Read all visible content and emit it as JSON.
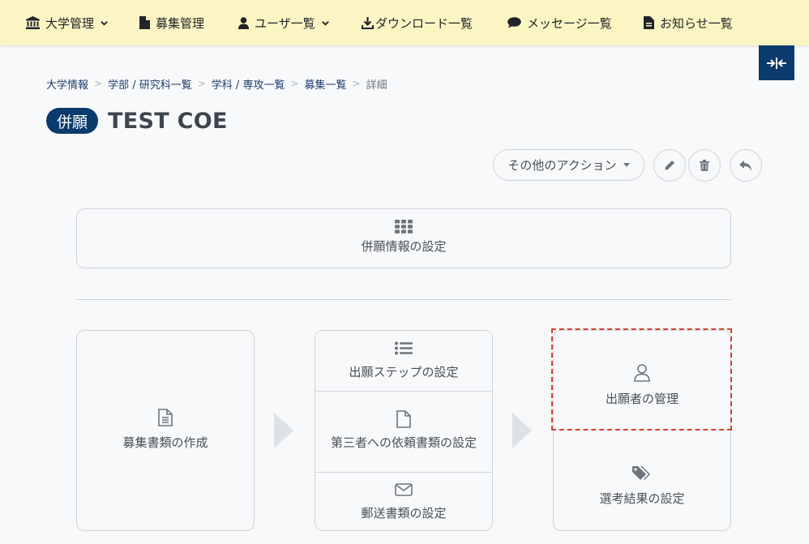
{
  "nav": {
    "items": [
      {
        "label": "大学管理",
        "icon": "university-icon",
        "dropdown": true
      },
      {
        "label": "募集管理",
        "icon": "file-icon",
        "dropdown": false
      },
      {
        "label": "ユーザ一覧",
        "icon": "user-icon",
        "dropdown": true
      },
      {
        "label": "ダウンロード一覧",
        "icon": "download-icon",
        "dropdown": false
      },
      {
        "label": "メッセージ一覧",
        "icon": "comment-icon",
        "dropdown": false
      },
      {
        "label": "お知らせ一覧",
        "icon": "document-icon",
        "dropdown": false
      }
    ],
    "background": "#fbf5c4"
  },
  "breadcrumb": {
    "items": [
      "大学情報",
      "学部 / 研究科一覧",
      "学科 / 専攻一覧",
      "募集一覧"
    ],
    "current": "詳細",
    "separator": ">"
  },
  "title": {
    "badge": "併願",
    "text": "TEST COE"
  },
  "actions": {
    "more_label": "その他のアクション",
    "edit_icon": "pencil-icon",
    "delete_icon": "trash-icon",
    "back_icon": "reply-icon"
  },
  "cards": {
    "settings": "併願情報の設定",
    "create_docs": "募集書類の作成",
    "apply_steps": "出願ステップの設定",
    "third_party": "第三者への依頼書類の設定",
    "mail_docs": "郵送書類の設定",
    "applicants": "出願者の管理",
    "results": "選考結果の設定"
  },
  "colors": {
    "brand": "#0b3a6c",
    "highlight": "#d6402b"
  }
}
